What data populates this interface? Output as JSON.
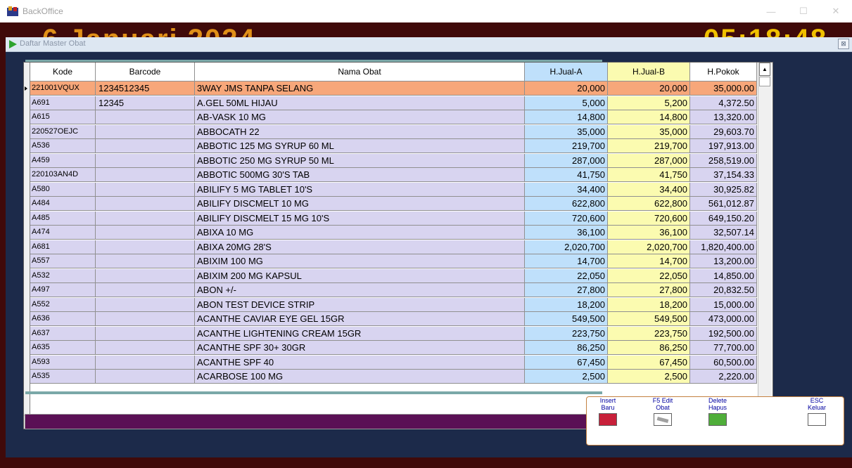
{
  "window": {
    "title": "BackOffice",
    "minimize": "—",
    "maximize": "☐",
    "close": "✕"
  },
  "banner": {
    "date_text": "6 Januari 2024",
    "time_text": "05:18:48"
  },
  "child": {
    "title": "Daftar Master Obat",
    "close": "⊠"
  },
  "grid": {
    "headers": {
      "kode": "Kode",
      "barcode": "Barcode",
      "nama": "Nama Obat",
      "jual_a": "H.Jual-A",
      "jual_b": "H.Jual-B",
      "pokok": "H.Pokok"
    },
    "colors": {
      "selected_row": "#f7a77a",
      "row_bg": "#d8d4f0",
      "jual_a_bg": "#bfe0fb",
      "jual_b_bg": "#fbfbb0"
    },
    "rows": [
      {
        "kode": "221001VQUX",
        "barcode": "1234512345",
        "nama": "3WAY JMS TANPA SELANG",
        "ja": "20,000",
        "jb": "20,000",
        "hp": "35,000.00"
      },
      {
        "kode": "A691",
        "barcode": "12345",
        "nama": "A.GEL 50ML HIJAU",
        "ja": "5,000",
        "jb": "5,200",
        "hp": "4,372.50"
      },
      {
        "kode": "A615",
        "barcode": "",
        "nama": "AB-VASK 10 MG",
        "ja": "14,800",
        "jb": "14,800",
        "hp": "13,320.00"
      },
      {
        "kode": "220527OEJC",
        "barcode": "",
        "nama": "ABBOCATH  22",
        "ja": "35,000",
        "jb": "35,000",
        "hp": "29,603.70"
      },
      {
        "kode": "A536",
        "barcode": "",
        "nama": "ABBOTIC 125 MG SYRUP 60 ML",
        "ja": "219,700",
        "jb": "219,700",
        "hp": "197,913.00"
      },
      {
        "kode": "A459",
        "barcode": "",
        "nama": "ABBOTIC 250 MG SYRUP 50 ML",
        "ja": "287,000",
        "jb": "287,000",
        "hp": "258,519.00"
      },
      {
        "kode": "220103AN4D",
        "barcode": "",
        "nama": "ABBOTIC 500MG 30'S TAB",
        "ja": "41,750",
        "jb": "41,750",
        "hp": "37,154.33"
      },
      {
        "kode": "A580",
        "barcode": "",
        "nama": "ABILIFY 5 MG TABLET 10'S",
        "ja": "34,400",
        "jb": "34,400",
        "hp": "30,925.82"
      },
      {
        "kode": "A484",
        "barcode": "",
        "nama": "ABILIFY DISCMELT 10 MG",
        "ja": "622,800",
        "jb": "622,800",
        "hp": "561,012.87"
      },
      {
        "kode": "A485",
        "barcode": "",
        "nama": "ABILIFY DISCMELT 15 MG 10'S",
        "ja": "720,600",
        "jb": "720,600",
        "hp": "649,150.20"
      },
      {
        "kode": "A474",
        "barcode": "",
        "nama": "ABIXA 10 MG",
        "ja": "36,100",
        "jb": "36,100",
        "hp": "32,507.14"
      },
      {
        "kode": "A681",
        "barcode": "",
        "nama": "ABIXA 20MG 28'S",
        "ja": "2,020,700",
        "jb": "2,020,700",
        "hp": "1,820,400.00"
      },
      {
        "kode": "A557",
        "barcode": "",
        "nama": "ABIXIM 100 MG",
        "ja": "14,700",
        "jb": "14,700",
        "hp": "13,200.00"
      },
      {
        "kode": "A532",
        "barcode": "",
        "nama": "ABIXIM 200 MG KAPSUL",
        "ja": "22,050",
        "jb": "22,050",
        "hp": "14,850.00"
      },
      {
        "kode": "A497",
        "barcode": "",
        "nama": "ABON +/-",
        "ja": "27,800",
        "jb": "27,800",
        "hp": "20,832.50"
      },
      {
        "kode": "A552",
        "barcode": "",
        "nama": "ABON TEST DEVICE STRIP",
        "ja": "18,200",
        "jb": "18,200",
        "hp": "15,000.00"
      },
      {
        "kode": "A636",
        "barcode": "",
        "nama": "ACANTHE CAVIAR EYE GEL 15GR",
        "ja": "549,500",
        "jb": "549,500",
        "hp": "473,000.00"
      },
      {
        "kode": "A637",
        "barcode": "",
        "nama": "ACANTHE LIGHTENING CREAM 15GR",
        "ja": "223,750",
        "jb": "223,750",
        "hp": "192,500.00"
      },
      {
        "kode": "A635",
        "barcode": "",
        "nama": "ACANTHE SPF 30+ 30GR",
        "ja": "86,250",
        "jb": "86,250",
        "hp": "77,700.00"
      },
      {
        "kode": "A593",
        "barcode": "",
        "nama": "ACANTHE SPF 40",
        "ja": "67,450",
        "jb": "67,450",
        "hp": "60,500.00"
      },
      {
        "kode": "A535",
        "barcode": "",
        "nama": "ACARBOSE 100 MG",
        "ja": "2,500",
        "jb": "2,500",
        "hp": "2,220.00"
      }
    ],
    "scroll_up": "▲",
    "scroll_down": "▼",
    "scroll_left": "◀",
    "scroll_right": "▶"
  },
  "toolbar": {
    "insert": {
      "line1": "Insert",
      "line2": "Baru",
      "icon": "insert-record-icon"
    },
    "edit": {
      "line1": "F5  Edit",
      "line2": "Obat",
      "icon": "edit-record-icon"
    },
    "delete": {
      "line1": "Delete",
      "line2": "Hapus",
      "icon": "delete-record-icon"
    },
    "exit": {
      "line1": "ESC",
      "line2": "Keluar",
      "icon": "play-exit-icon"
    }
  }
}
